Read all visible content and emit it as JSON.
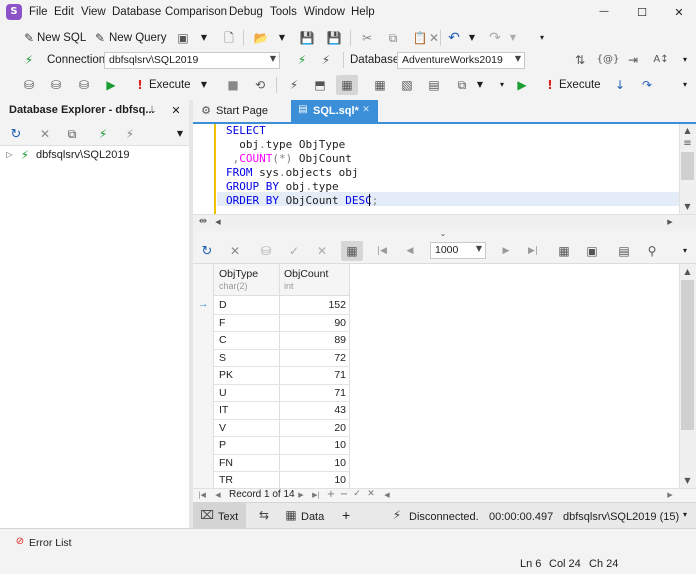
{
  "app": {
    "logo_letter": "S"
  },
  "menu": {
    "items": [
      "File",
      "Edit",
      "View",
      "Database",
      "Comparison",
      "Debug",
      "Tools",
      "Window",
      "Help"
    ]
  },
  "window_controls": {
    "minimize": "—",
    "maximize": "☐",
    "close": "✕"
  },
  "toolbar1": {
    "new_sql": "New SQL",
    "new_query": "New Query",
    "connection_label": "Connection",
    "connection_value": "dbfsqlsrv\\SQL2019",
    "database_label": "Database",
    "database_value": "AdventureWorks2019",
    "execute_label": "Execute",
    "execute_label2": "Execute"
  },
  "explorer": {
    "title": "Database Explorer - dbfsq...",
    "pin": "📌",
    "close": "✕",
    "tree": [
      {
        "label": "dbfsqlsrv\\SQL2019"
      }
    ]
  },
  "tabs": {
    "start_page": "Start Page",
    "sql_tab": "SQL.sql*",
    "sql_tab_close": "✕"
  },
  "editor": {
    "lines": [
      [
        {
          "t": "SELECT",
          "c": "kw"
        }
      ],
      [
        {
          "t": "  obj",
          "c": "nm"
        },
        {
          "t": ".",
          "c": "op"
        },
        {
          "t": "type ObjType",
          "c": "nm"
        }
      ],
      [
        {
          "t": " ,",
          "c": "op"
        },
        {
          "t": "COUNT",
          "c": "fn"
        },
        {
          "t": "(*)",
          "c": "op"
        },
        {
          "t": " ObjCount",
          "c": "nm"
        }
      ],
      [
        {
          "t": "FROM",
          "c": "kw"
        },
        {
          "t": " sys",
          "c": "nm"
        },
        {
          "t": ".",
          "c": "op"
        },
        {
          "t": "objects obj",
          "c": "nm"
        }
      ],
      [
        {
          "t": "GROUP BY",
          "c": "kw"
        },
        {
          "t": " obj",
          "c": "nm"
        },
        {
          "t": ".",
          "c": "op"
        },
        {
          "t": "type",
          "c": "nm"
        }
      ],
      [
        {
          "t": "ORDER BY",
          "c": "kw"
        },
        {
          "t": " ObjCount ",
          "c": "nm"
        },
        {
          "t": "DESC",
          "c": "kw"
        },
        {
          "t": ";",
          "c": "op"
        }
      ]
    ]
  },
  "results_toolbar": {
    "page_size": "1000"
  },
  "grid": {
    "columns": [
      {
        "name": "ObjType",
        "type": "char(2)"
      },
      {
        "name": "ObjCount",
        "type": "int"
      }
    ],
    "rows": [
      [
        "D",
        "152"
      ],
      [
        "F",
        "90"
      ],
      [
        "C",
        "89"
      ],
      [
        "S",
        "72"
      ],
      [
        "PK",
        "71"
      ],
      [
        "U",
        "71"
      ],
      [
        "IT",
        "43"
      ],
      [
        "V",
        "20"
      ],
      [
        "P",
        "10"
      ],
      [
        "FN",
        "10"
      ],
      [
        "TR",
        "10"
      ]
    ],
    "current_row_marker": "→"
  },
  "navigator": {
    "record_text": "Record 1 of 14"
  },
  "bottom_tabs": {
    "text": "Text",
    "data": "Data",
    "add": "+",
    "status": "Disconnected.",
    "elapsed": "00:00:00.497",
    "server": "dbfsqlsrv\\SQL2019 (15)"
  },
  "error_list": {
    "label": "Error List"
  },
  "statusbar": {
    "ln": "Ln 6",
    "col": "Col 24",
    "ch": "Ch 24"
  },
  "colors": {
    "accent": "#007acc",
    "tab_active": "#3b8ed8",
    "keyword": "#0000e8",
    "function": "#ff00ff",
    "execute_green": "#1a9c33",
    "execute_red": "#e02020"
  }
}
